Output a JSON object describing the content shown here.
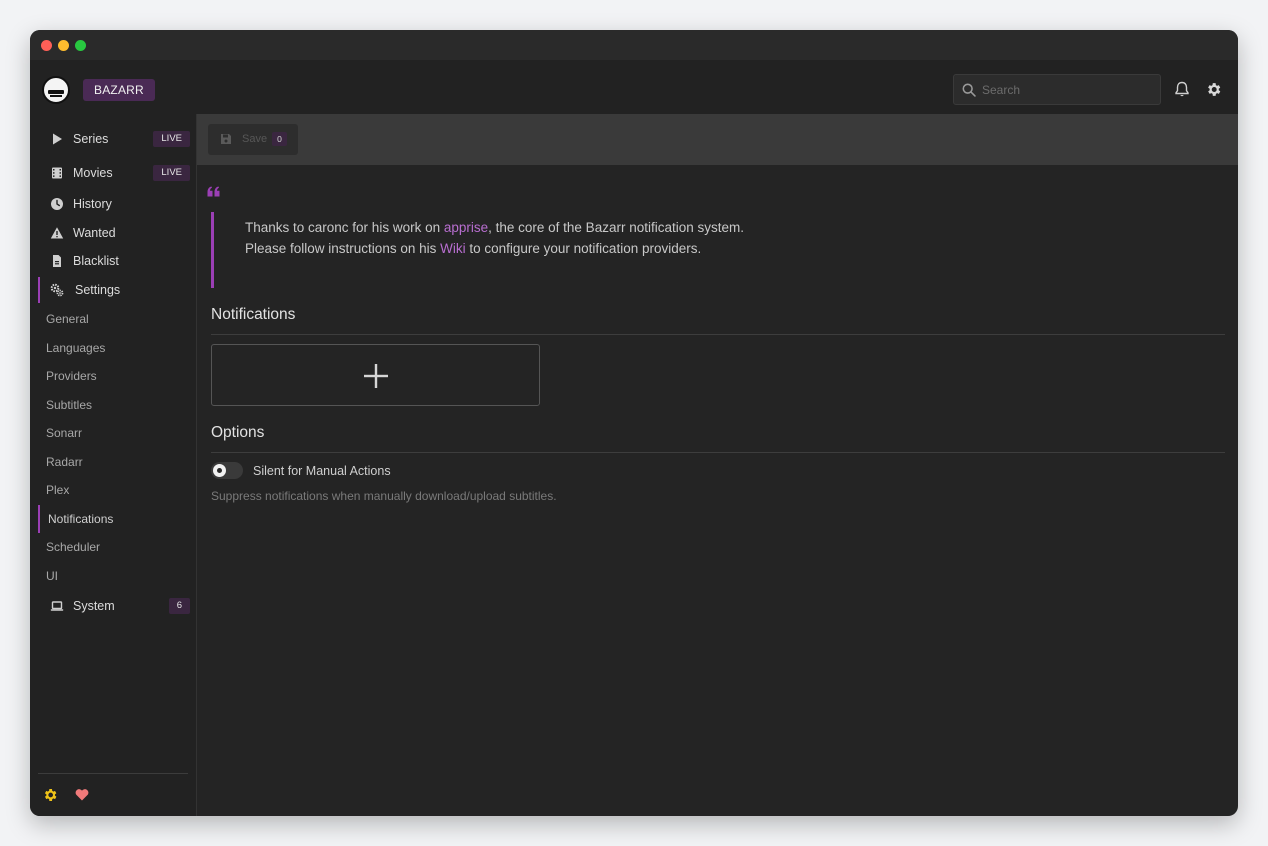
{
  "app": {
    "brand": "BAZARR"
  },
  "header": {
    "search_placeholder": "Search"
  },
  "sidebar": {
    "items": [
      {
        "label": "Series",
        "icon": "play-icon",
        "badge": "LIVE"
      },
      {
        "label": "Movies",
        "icon": "film-icon",
        "badge": "LIVE"
      },
      {
        "label": "History",
        "icon": "clock-icon"
      },
      {
        "label": "Wanted",
        "icon": "warning-icon"
      },
      {
        "label": "Blacklist",
        "icon": "file-icon"
      },
      {
        "label": "Settings",
        "icon": "cogs-icon",
        "active": true
      }
    ],
    "settings_subitems": [
      {
        "label": "General"
      },
      {
        "label": "Languages"
      },
      {
        "label": "Providers"
      },
      {
        "label": "Subtitles"
      },
      {
        "label": "Sonarr"
      },
      {
        "label": "Radarr"
      },
      {
        "label": "Plex"
      },
      {
        "label": "Notifications",
        "active": true
      },
      {
        "label": "Scheduler"
      },
      {
        "label": "UI"
      }
    ],
    "system": {
      "label": "System",
      "icon": "laptop-icon",
      "badge": "6"
    }
  },
  "toolbar": {
    "save_label": "Save",
    "save_count": "0"
  },
  "quote": {
    "line1_prefix": "Thanks to caronc for his work on ",
    "line1_link": "apprise",
    "line1_suffix": ", the core of the Bazarr notification system.",
    "line2_prefix": "Please follow instructions on his ",
    "line2_link": "Wiki",
    "line2_suffix": " to configure your notification providers."
  },
  "sections": {
    "notifications_title": "Notifications",
    "options_title": "Options"
  },
  "options": {
    "silent_label": "Silent for Manual Actions",
    "silent_enabled": false,
    "silent_hint": "Suppress notifications when manually download/upload subtitles."
  },
  "colors": {
    "accent": "#9b3fb5",
    "link": "#b86ed0",
    "badge_bg": "#3a2640",
    "footer_gear": "#f0c419",
    "footer_heart": "#f07a7a"
  }
}
